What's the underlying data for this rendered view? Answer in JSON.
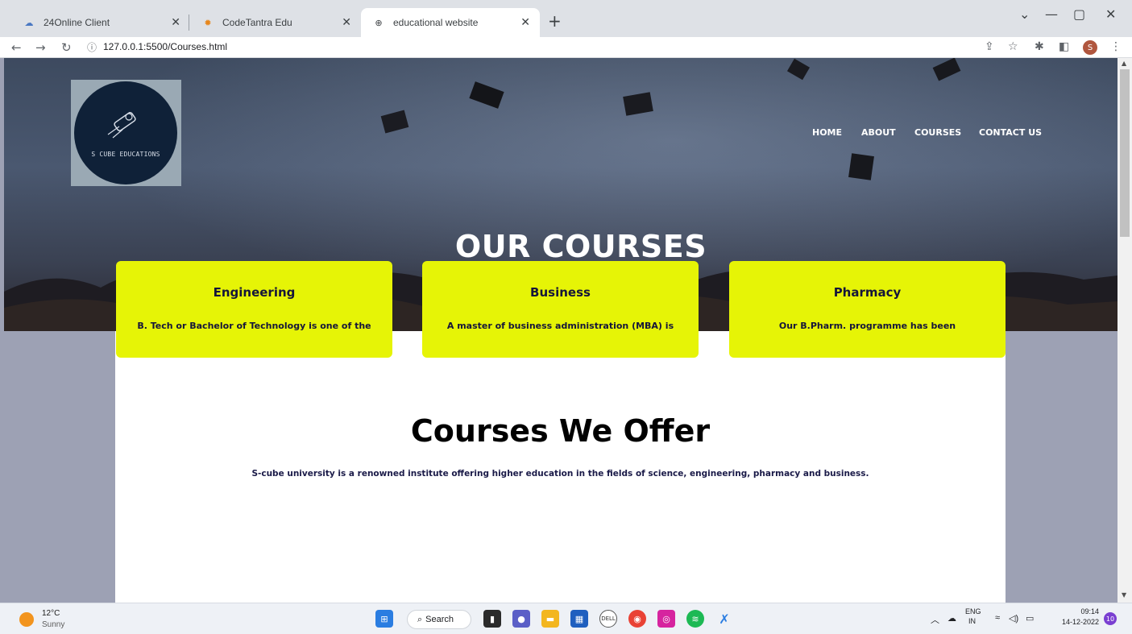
{
  "browser": {
    "tabs": [
      {
        "title": "24Online Client",
        "icon": "cloud-icon",
        "active": false
      },
      {
        "title": "CodeTantra Edu",
        "icon": "sun-icon",
        "active": false
      },
      {
        "title": "educational website",
        "icon": "globe-icon",
        "active": true
      }
    ],
    "url": "127.0.0.1:5500/Courses.html",
    "profile_initial": "S"
  },
  "site": {
    "logo_text": "S CUBE EDUCATIONS",
    "nav": [
      {
        "label": "HOME"
      },
      {
        "label": "ABOUT"
      },
      {
        "label": "COURSES"
      },
      {
        "label": "CONTACT US"
      }
    ],
    "hero_title": "OUR COURSES",
    "section_title": "Courses We Offer",
    "section_subtitle": "S-cube university is a renowned institute offering higher education in the fields of science, engineering, pharmacy and business.",
    "cards": [
      {
        "title": "Engineering",
        "text": "B. Tech or Bachelor of Technology is one of the"
      },
      {
        "title": "Business",
        "text": "A master of business administration (MBA) is"
      },
      {
        "title": "Pharmacy",
        "text": "Our B.Pharm. programme has been"
      }
    ],
    "colors": {
      "card": "#e6f406",
      "overlay": "#9da1b4",
      "text_dark": "#15153a"
    }
  },
  "taskbar": {
    "weather_temp": "12°C",
    "weather_desc": "Sunny",
    "search_label": "Search",
    "lang_top": "ENG",
    "lang_bottom": "IN",
    "time": "09:14",
    "date": "14-12-2022",
    "notification_count": "10"
  }
}
